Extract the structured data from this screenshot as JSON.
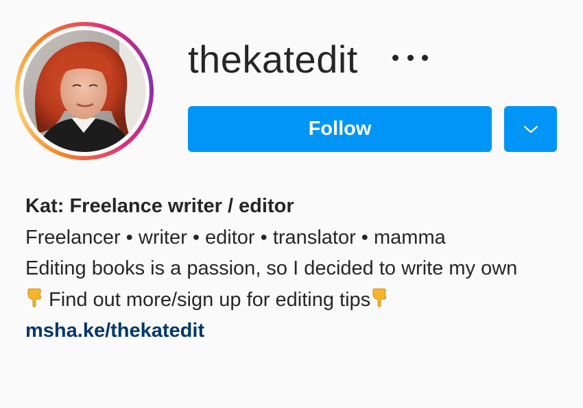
{
  "profile": {
    "username": "thekatedit",
    "more_icon": "more-horizontal-icon",
    "avatar_icon": "profile-photo"
  },
  "actions": {
    "follow_label": "Follow",
    "dropdown_icon": "chevron-down-icon"
  },
  "bio": {
    "name": "Kat: Freelance writer / editor",
    "line1": "Freelancer • writer • editor • translator • mamma",
    "line2": "Editing books is a passion, so I decided to write my own",
    "line3_text": " Find out more/sign up for editing tips",
    "pointing_icon": "pointing-down-emoji",
    "link": "msha.ke/thekatedit"
  },
  "colors": {
    "button_blue": "#0095f6",
    "link_blue": "#00376b",
    "text": "#262626",
    "background": "#fafafa",
    "emoji_yellow": "#f7b52e"
  }
}
